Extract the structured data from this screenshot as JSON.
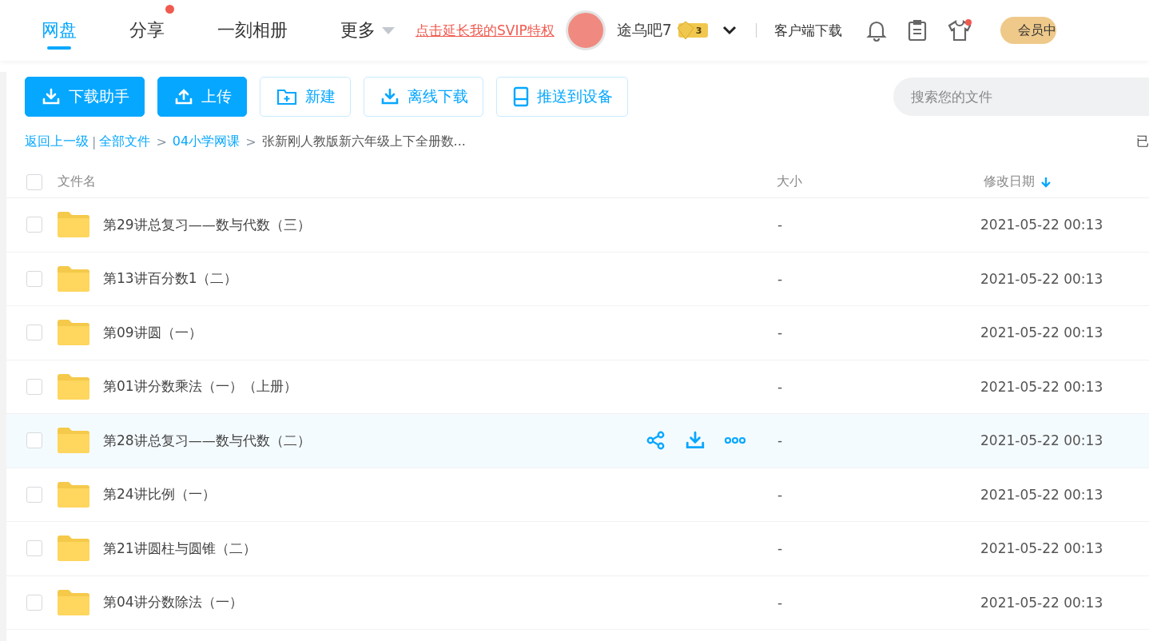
{
  "nav": {
    "tabs": [
      {
        "label": "网盘",
        "selected": true
      },
      {
        "label": "分享",
        "selected": false,
        "dot": true
      },
      {
        "label": "一刻相册",
        "selected": false
      },
      {
        "label": "更多",
        "selected": false,
        "dropdown": true
      }
    ],
    "promo_link": "点击延长我的SVIP特权",
    "username": "途乌吧7",
    "level_badge": "3",
    "client_download": "客户端下载",
    "member_button": "会员中"
  },
  "toolbar": {
    "buttons": [
      {
        "label": "下载助手",
        "kind": "primary"
      },
      {
        "label": "上传",
        "kind": "primary"
      },
      {
        "label": "新建",
        "kind": "outline"
      },
      {
        "label": "离线下载",
        "kind": "outline"
      },
      {
        "label": "推送到设备",
        "kind": "outline"
      }
    ],
    "search": {
      "placeholder": "搜索您的文件"
    }
  },
  "breadcrumb": {
    "back": "返回上一级",
    "divider": "|",
    "items": [
      {
        "label": "全部文件",
        "link": true
      },
      {
        "separator": ">",
        "label": "04小学网课",
        "link": true
      },
      {
        "separator": ">",
        "label": "张新刚人教版新六年级上下全册数...",
        "link": false
      }
    ],
    "right_text": "已"
  },
  "table": {
    "columns": [
      "文件名",
      "大小",
      "修改日期"
    ],
    "all_checked": false,
    "rows": [
      {
        "name": "第29讲总复习——数与代数（三）",
        "size": "-",
        "date": "2021-05-22 00:13",
        "hovered": false,
        "checked": false
      },
      {
        "name": "第13讲百分数1（二）",
        "size": "-",
        "date": "2021-05-22 00:13",
        "hovered": false,
        "checked": false
      },
      {
        "name": "第09讲圆（一）",
        "size": "-",
        "date": "2021-05-22 00:13",
        "hovered": false,
        "checked": false
      },
      {
        "name": "第01讲分数乘法（一）（上册）",
        "size": "-",
        "date": "2021-05-22 00:13",
        "hovered": false,
        "checked": false
      },
      {
        "name": "第28讲总复习——数与代数（二）",
        "size": "-",
        "date": "2021-05-22 00:13",
        "hovered": true,
        "checked": false
      },
      {
        "name": "第24讲比例（一）",
        "size": "-",
        "date": "2021-05-22 00:13",
        "hovered": false,
        "checked": false
      },
      {
        "name": "第21讲圆柱与圆锥（二）",
        "size": "-",
        "date": "2021-05-22 00:13",
        "hovered": false,
        "checked": false
      },
      {
        "name": "第04讲分数除法（一）",
        "size": "-",
        "date": "2021-05-22 00:13",
        "hovered": false,
        "checked": false
      }
    ]
  }
}
